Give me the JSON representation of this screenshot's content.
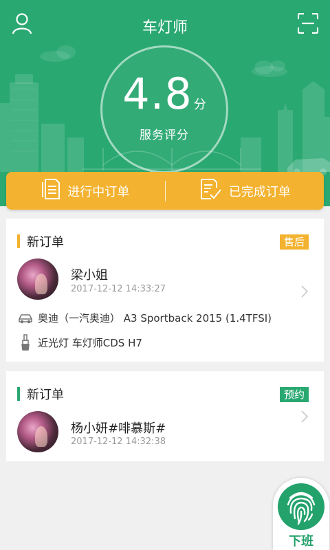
{
  "header": {
    "title": "车灯师",
    "score": "4.8",
    "score_unit": "分",
    "score_label": "服务评分",
    "left_icon": "user-icon",
    "right_icon": "scan-icon"
  },
  "tabs": [
    {
      "label": "进行中订单",
      "icon": "document-icon"
    },
    {
      "label": "已完成订单",
      "icon": "document-check-icon"
    }
  ],
  "orders": [
    {
      "title": "新订单",
      "badge": "售后",
      "badge_color": "#f3b22f",
      "customer": "梁小姐",
      "time": "2017-12-12 14:33:27",
      "car": "奥迪（一汽奥迪） A3 Sportback 2015 (1.4TFSI)",
      "product": "近光灯 车灯师CDS H7"
    },
    {
      "title": "新订单",
      "badge": "预约",
      "badge_color": "#2aa872",
      "customer": "杨小妍#啡慕斯#",
      "time": "2017-12-12 14:32:38"
    }
  ],
  "fab": {
    "label": "下班",
    "icon": "fingerprint-icon"
  },
  "colors": {
    "primary": "#2aa872",
    "accent": "#f3b22f"
  }
}
